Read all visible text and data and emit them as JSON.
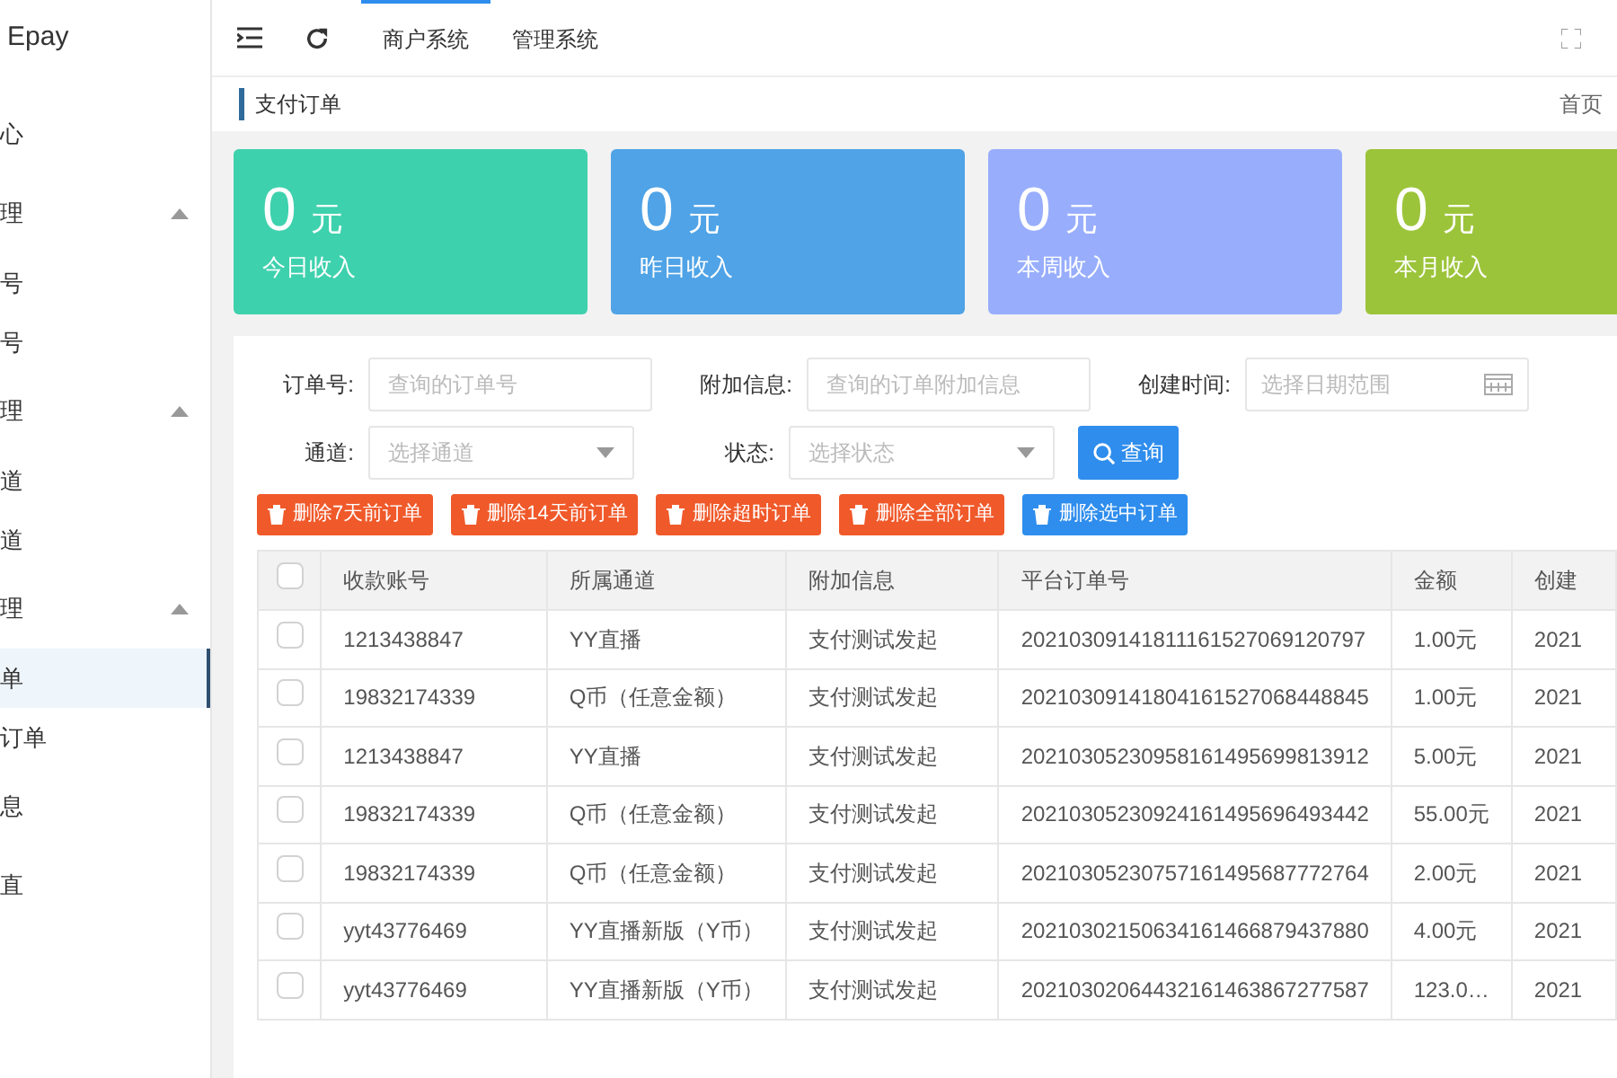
{
  "sidebar": {
    "brand": "Epay",
    "items": [
      {
        "label": "心",
        "selected": false
      },
      {
        "label": "理",
        "expanded": true,
        "children": [
          {
            "label": "号",
            "selected": false
          },
          {
            "label": "号",
            "selected": false
          }
        ]
      },
      {
        "label": "理",
        "expanded": true,
        "children": [
          {
            "label": "道",
            "selected": false
          },
          {
            "label": "道",
            "selected": false
          }
        ]
      },
      {
        "label": "理",
        "expanded": true,
        "children": [
          {
            "label": "单",
            "selected": true
          },
          {
            "label": "订单",
            "selected": false
          }
        ]
      },
      {
        "label": "息",
        "selected": false
      },
      {
        "label": "直",
        "selected": false
      }
    ]
  },
  "header": {
    "tabs": [
      {
        "label": "商户系统",
        "selected": true
      },
      {
        "label": "管理系统",
        "selected": false
      }
    ]
  },
  "breadcrumb": {
    "title": "支付订单",
    "home": "首页"
  },
  "stats": [
    {
      "value": "0",
      "unit": "元",
      "label": "今日收入",
      "color": "#3ed1ad"
    },
    {
      "value": "0",
      "unit": "元",
      "label": "昨日收入",
      "color": "#4fa3e6"
    },
    {
      "value": "0",
      "unit": "元",
      "label": "本周收入",
      "color": "#98aefc"
    },
    {
      "value": "0",
      "unit": "元",
      "label": "本月收入",
      "color": "#9cc43a"
    }
  ],
  "filters": [
    [
      {
        "kind": "text",
        "label": "订单号:",
        "placeholder": "查询的订单号"
      },
      {
        "kind": "text",
        "label": "附加信息:",
        "placeholder": "查询的订单附加信息"
      },
      {
        "kind": "date",
        "label": "创建时间:",
        "placeholder": "选择日期范围"
      }
    ],
    [
      {
        "kind": "select",
        "label": "通道:",
        "placeholder": "选择通道"
      },
      {
        "kind": "select",
        "label": "状态:",
        "placeholder": "选择状态"
      }
    ]
  ],
  "search_button": "查询",
  "actions": [
    {
      "label": "删除7天前订单",
      "color": "#f0592a"
    },
    {
      "label": "删除14天前订单",
      "color": "#f0592a"
    },
    {
      "label": "删除超时订单",
      "color": "#f0592a"
    },
    {
      "label": "删除全部订单",
      "color": "#f0592a"
    },
    {
      "label": "删除选中订单",
      "color": "#2e8ded"
    }
  ],
  "table": {
    "all_checked": false,
    "columns": [
      "收款账号",
      "所属通道",
      "附加信息",
      "平台订单号",
      "金额",
      "创建"
    ],
    "rows": [
      {
        "checked": false,
        "cells": [
          "1213438847",
          "YY直播",
          "支付测试发起",
          "20210309141811161527069120797",
          "1.00元",
          "2021"
        ]
      },
      {
        "checked": false,
        "cells": [
          "19832174339",
          "Q币（任意金额）",
          "支付测试发起",
          "20210309141804161527068448845",
          "1.00元",
          "2021"
        ]
      },
      {
        "checked": false,
        "cells": [
          "1213438847",
          "YY直播",
          "支付测试发起",
          "20210305230958161495699813912",
          "5.00元",
          "2021"
        ]
      },
      {
        "checked": false,
        "cells": [
          "19832174339",
          "Q币（任意金额）",
          "支付测试发起",
          "20210305230924161495696493442",
          "55.00元",
          "2021"
        ]
      },
      {
        "checked": false,
        "cells": [
          "19832174339",
          "Q币（任意金额）",
          "支付测试发起",
          "20210305230757161495687772764",
          "2.00元",
          "2021"
        ]
      },
      {
        "checked": false,
        "cells": [
          "yyt43776469",
          "YY直播新版（Y币）",
          "支付测试发起",
          "20210302150634161466879437880",
          "4.00元",
          "2021"
        ]
      },
      {
        "checked": false,
        "cells": [
          "yyt43776469",
          "YY直播新版（Y币）",
          "支付测试发起",
          "20210302064432161463867277587",
          "123.0…",
          "2021"
        ]
      }
    ]
  }
}
